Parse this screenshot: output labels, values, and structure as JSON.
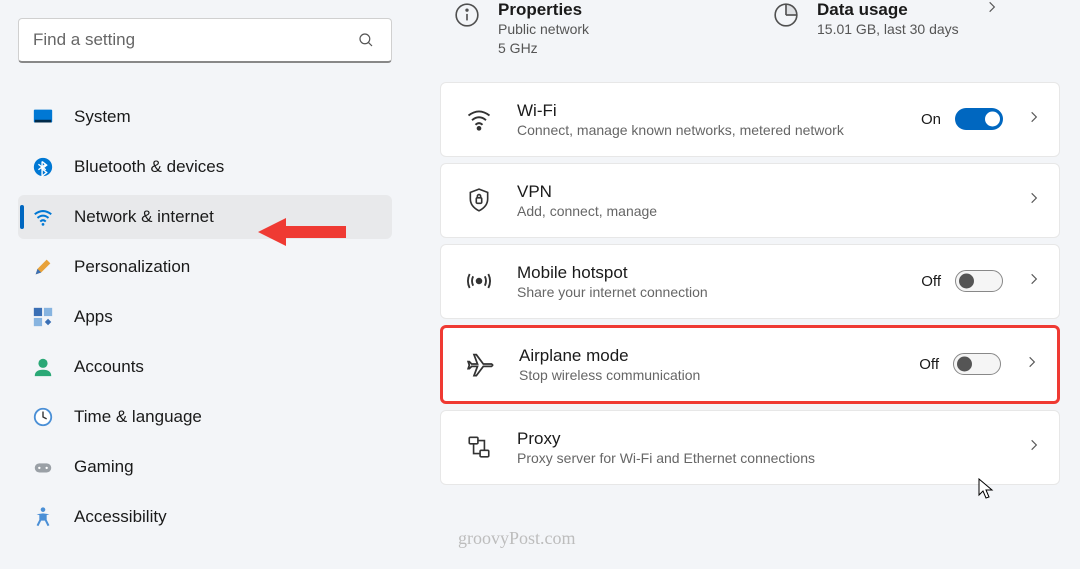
{
  "search": {
    "placeholder": "Find a setting"
  },
  "sidebar": {
    "items": [
      {
        "label": "System"
      },
      {
        "label": "Bluetooth & devices"
      },
      {
        "label": "Network & internet"
      },
      {
        "label": "Personalization"
      },
      {
        "label": "Apps"
      },
      {
        "label": "Accounts"
      },
      {
        "label": "Time & language"
      },
      {
        "label": "Gaming"
      },
      {
        "label": "Accessibility"
      }
    ]
  },
  "top": {
    "properties": {
      "title": "Properties",
      "sub1": "Public network",
      "sub2": "5 GHz"
    },
    "data_usage": {
      "title": "Data usage",
      "sub1": "15.01 GB, last 30 days"
    }
  },
  "cards": {
    "wifi": {
      "title": "Wi-Fi",
      "sub": "Connect, manage known networks, metered network",
      "state": "On"
    },
    "vpn": {
      "title": "VPN",
      "sub": "Add, connect, manage"
    },
    "hotspot": {
      "title": "Mobile hotspot",
      "sub": "Share your internet connection",
      "state": "Off"
    },
    "airplane": {
      "title": "Airplane mode",
      "sub": "Stop wireless communication",
      "state": "Off"
    },
    "proxy": {
      "title": "Proxy",
      "sub": "Proxy server for Wi-Fi and Ethernet connections"
    }
  },
  "watermark": "groovyPost.com"
}
